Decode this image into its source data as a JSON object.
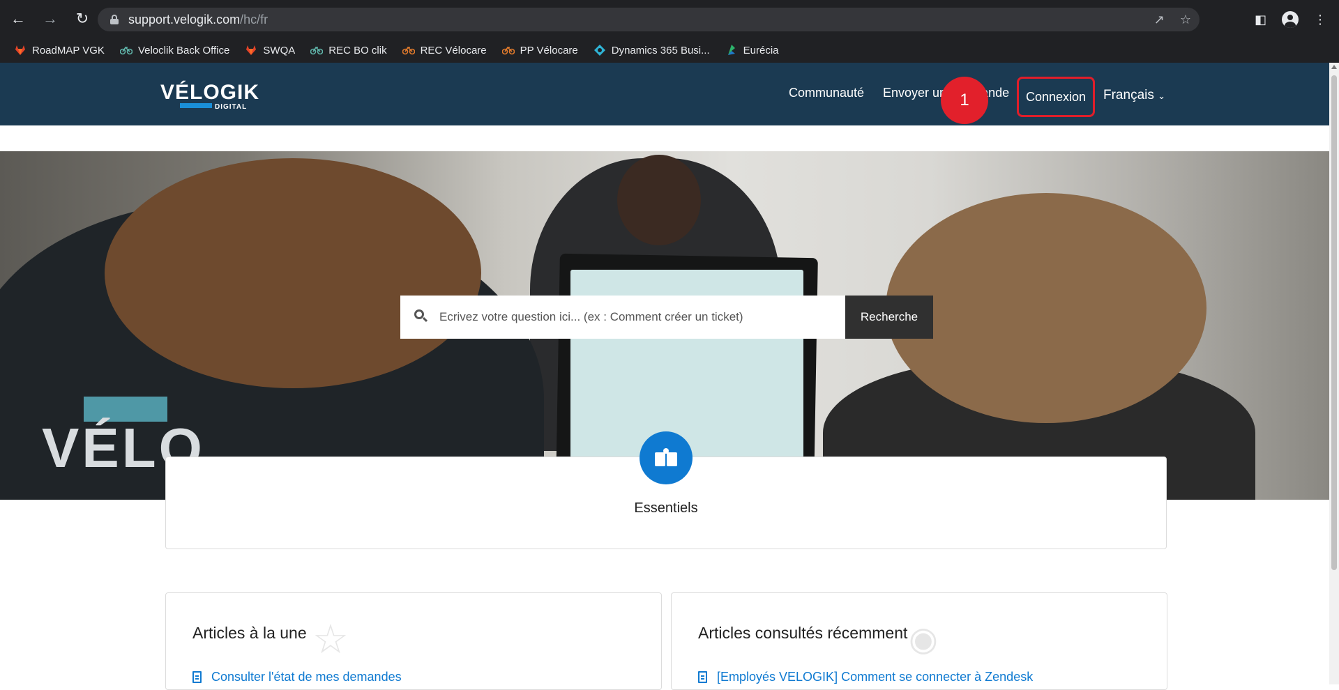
{
  "browser": {
    "url_host": "support.velogik.com",
    "url_path": "/hc/fr",
    "bookmarks": [
      {
        "label": "RoadMAP VGK",
        "icon": "gitlab-icon"
      },
      {
        "label": "Veloclik Back Office",
        "icon": "bike-icon"
      },
      {
        "label": "SWQA",
        "icon": "gitlab-icon"
      },
      {
        "label": "REC BO clik",
        "icon": "bike-icon"
      },
      {
        "label": "REC Vélocare",
        "icon": "bike-icon"
      },
      {
        "label": "PP Vélocare",
        "icon": "bike-icon"
      },
      {
        "label": "Dynamics 365 Busi...",
        "icon": "dynamics-icon"
      },
      {
        "label": "Eurécia",
        "icon": "eurecia-icon"
      }
    ]
  },
  "site": {
    "logo_word": "VÉLOGIK",
    "logo_sub": "DIGITAL",
    "nav": {
      "community": "Communauté",
      "submit": "Envoyer une demande",
      "login": "Connexion",
      "language": "Français"
    },
    "step_badge": "1",
    "hero": {
      "search_placeholder": "Ecrivez votre question ici... (ex : Comment créer un ticket)",
      "search_button": "Recherche",
      "photo_text": "VÉLO"
    },
    "category": {
      "label": "Essentiels"
    },
    "promoted": {
      "title": "Articles à la une",
      "first_link": "Consulter l'état de mes demandes"
    },
    "recent": {
      "title": "Articles consultés récemment",
      "first_link": "[Employés VELOGIK] Comment se connecter à Zendesk"
    }
  },
  "colors": {
    "header_bg": "#1b3a52",
    "accent_blue": "#0f7ad1",
    "annotation_red": "#e2202b"
  }
}
